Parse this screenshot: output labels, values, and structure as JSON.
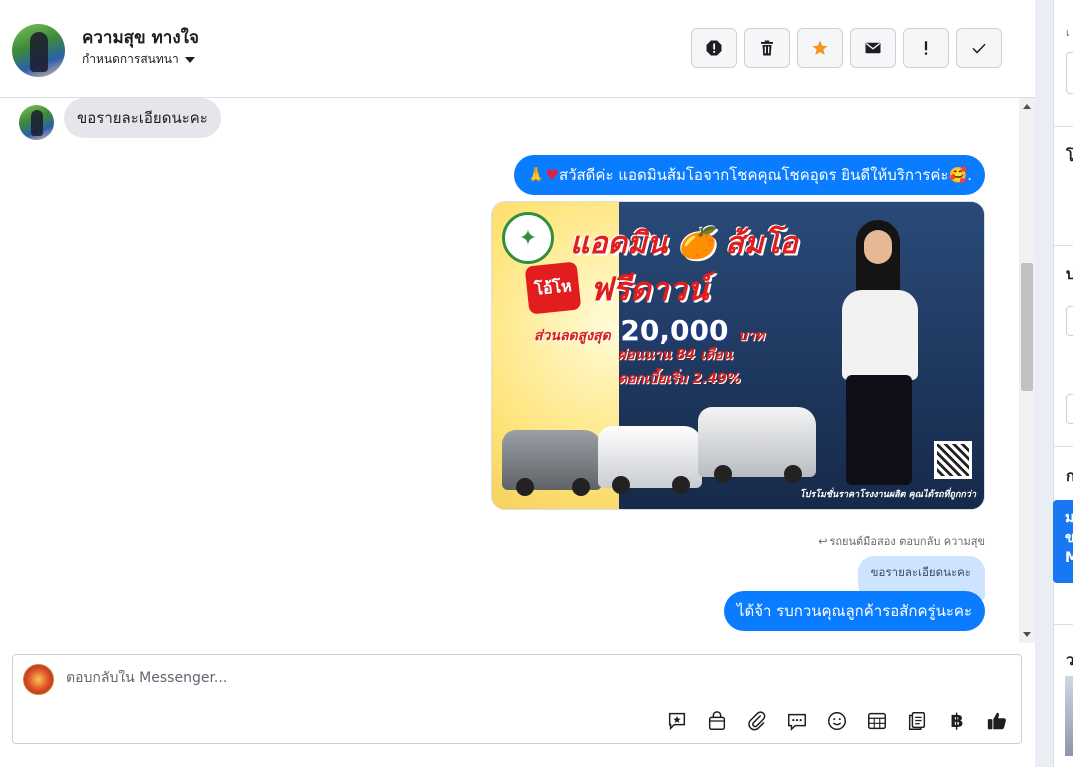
{
  "header": {
    "contact_name": "ความสุข ทางใจ",
    "conversation_settings": "กำหนดการสนทนา"
  },
  "actions": [
    {
      "name": "report-spam-button",
      "icon": "alert-octagon-icon"
    },
    {
      "name": "delete-button",
      "icon": "trash-icon"
    },
    {
      "name": "star-button",
      "icon": "star-icon",
      "color": "#f7931e"
    },
    {
      "name": "mark-unread-button",
      "icon": "envelope-icon"
    },
    {
      "name": "mark-important-button",
      "icon": "exclamation-icon"
    },
    {
      "name": "mark-done-button",
      "icon": "check-icon"
    }
  ],
  "messages": {
    "incoming_1": "ขอรายละเอียดนะคะ",
    "outgoing_1_emoji_left": "🙏",
    "outgoing_1_heart": "♥",
    "outgoing_1": " สวัสดีค่ะ แอดมินส้มโอจากโชคคุณโชคอุดร ยินดีให้บริการค่ะ ",
    "outgoing_1_emoji_right": "🥰",
    "outgoing_1_tail": ".",
    "reply_note": "รถยนต์มือสอง ตอบกลับ ความสุข",
    "quoted_text": "ขอรายละเอียดนะคะ",
    "outgoing_2": "ได้จ้า รบกวนคุณลูกค้ารอสักครู่นะคะ"
  },
  "promo": {
    "title": "แอดมิน 🍊 ส้มโอ",
    "burst": "โอ้โห",
    "headline": "ฟรีดาวน์",
    "discount_prefix": "ส่วนลดสูงสุด",
    "discount_value": "20,000",
    "discount_suffix": "บาท",
    "installment": "ผ่อนนาน 84 เดือน",
    "interest": "ดอกเบี้ยเริ่ม 2.49%",
    "footer": "โปรโมชั่นราคาโรงงานผลิต คุณได้รถที่ถูกกว่า"
  },
  "composer": {
    "placeholder": "ตอบกลับใน Messenger...",
    "tools": [
      "saved-reply-icon",
      "shop-bag-icon",
      "attachment-icon",
      "chat-bubbles-icon",
      "emoji-icon",
      "table-icon",
      "notes-icon",
      "baht-icon",
      "like-icon"
    ],
    "baht_symbol": "฿"
  },
  "right_panel": {
    "chars": [
      "โ",
      "บ",
      "ก",
      "ว"
    ],
    "blue_lines": [
      "ม",
      "ข",
      "M"
    ]
  },
  "colors": {
    "brand_blue": "#0a7cff",
    "star": "#f7931e"
  }
}
